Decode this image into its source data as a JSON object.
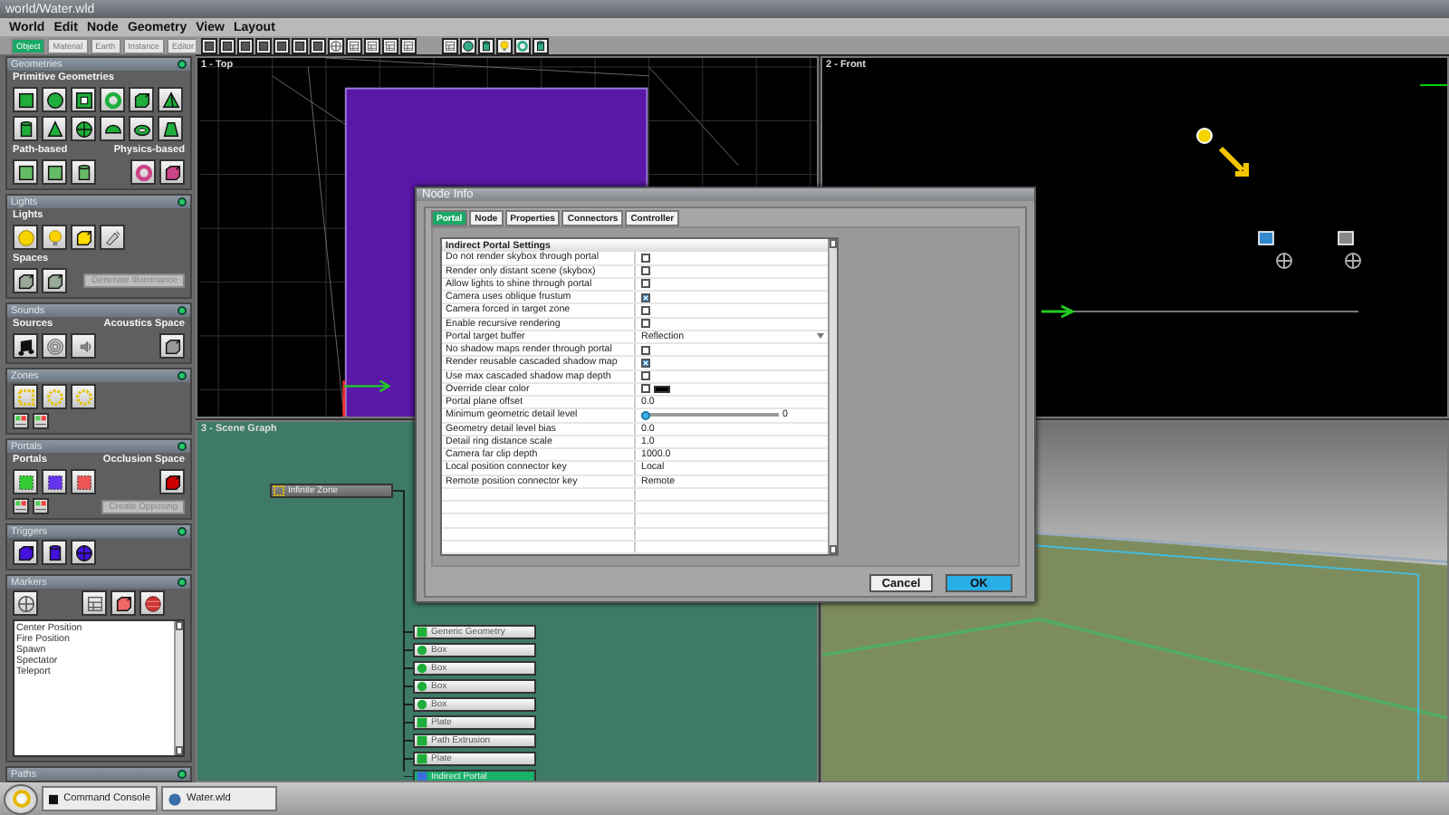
{
  "window": {
    "title": "world/Water.wld"
  },
  "menu": [
    "World",
    "Edit",
    "Node",
    "Geometry",
    "View",
    "Layout"
  ],
  "mode_tabs": [
    {
      "label": "Object",
      "selected": true
    },
    {
      "label": "Material",
      "selected": false
    },
    {
      "label": "Earth",
      "selected": false
    },
    {
      "label": "Instance",
      "selected": false
    },
    {
      "label": "Editor",
      "selected": false
    }
  ],
  "sidebar": {
    "geometries": {
      "title": "Geometries",
      "primitive_label": "Primitive Geometries",
      "path_label": "Path-based",
      "physics_label": "Physics-based"
    },
    "lights": {
      "title": "Lights",
      "lights_label": "Lights",
      "spaces_label": "Spaces",
      "button": {
        "label": "Generate Illuminance",
        "disabled": true
      }
    },
    "sounds": {
      "title": "Sounds",
      "sources_label": "Sources",
      "acoustics_label": "Acoustics Space"
    },
    "zones": {
      "title": "Zones"
    },
    "portals": {
      "title": "Portals",
      "portals_label": "Portals",
      "occlusion_label": "Occlusion Space",
      "button": {
        "label": "Create Opposing",
        "disabled": true
      }
    },
    "triggers": {
      "title": "Triggers"
    },
    "markers": {
      "title": "Markers",
      "list": [
        "Center Position",
        "Fire Position",
        "Spawn",
        "Spectator",
        "Teleport"
      ]
    },
    "paths": {
      "title": "Paths"
    }
  },
  "top_view": {
    "label": "1 - Top"
  },
  "front_view": {
    "label": "2 - Front"
  },
  "scene_graph": {
    "label": "3 - Scene Graph",
    "root": "Infinite Zone",
    "nodes": [
      {
        "label": "Generic Geometry",
        "kind": "plate",
        "selected": false
      },
      {
        "label": "Box",
        "kind": "box",
        "selected": false
      },
      {
        "label": "Box",
        "kind": "box",
        "selected": false
      },
      {
        "label": "Box",
        "kind": "box",
        "selected": false
      },
      {
        "label": "Box",
        "kind": "box",
        "selected": false
      },
      {
        "label": "Plate",
        "kind": "plate",
        "selected": false
      },
      {
        "label": "Path Extrusion",
        "kind": "path",
        "selected": false
      },
      {
        "label": "Plate",
        "kind": "plate",
        "selected": false
      },
      {
        "label": "Indirect Portal",
        "kind": "portal",
        "selected": true
      }
    ]
  },
  "dialog": {
    "title": "Node Info",
    "tabs": [
      {
        "label": "Portal",
        "selected": true
      },
      {
        "label": "Node",
        "selected": false
      },
      {
        "label": "Properties",
        "selected": false
      },
      {
        "label": "Connectors",
        "selected": false
      },
      {
        "label": "Controller",
        "selected": false
      }
    ],
    "section": "Indirect Portal Settings",
    "rows": [
      {
        "label": "Do not render skybox through portal",
        "kind": "check",
        "checked": false
      },
      {
        "label": "Render only distant scene (skybox)",
        "kind": "check",
        "checked": false
      },
      {
        "label": "Allow lights to shine through portal",
        "kind": "check",
        "checked": false
      },
      {
        "label": "Camera uses oblique frustum",
        "kind": "check",
        "checked": true
      },
      {
        "label": "Camera forced in target zone",
        "kind": "check",
        "checked": false
      },
      {
        "label": "Enable recursive rendering",
        "kind": "check",
        "checked": false
      },
      {
        "label": "Portal target buffer",
        "kind": "dropdown",
        "value": "Reflection"
      },
      {
        "label": "No shadow maps render through portal",
        "kind": "check",
        "checked": false
      },
      {
        "label": "Render reusable cascaded shadow map",
        "kind": "check",
        "checked": true
      },
      {
        "label": "Use max cascaded shadow map depth",
        "kind": "check",
        "checked": false
      },
      {
        "label": "Override clear color",
        "kind": "color",
        "checked": false,
        "color": "#000000"
      },
      {
        "label": "Portal plane offset",
        "kind": "text",
        "value": "0.0"
      },
      {
        "label": "Minimum geometric detail level",
        "kind": "slider",
        "level": 0,
        "reading": "0"
      },
      {
        "label": "Geometry detail level bias",
        "kind": "text",
        "value": "0.0"
      },
      {
        "label": "Detail ring distance scale",
        "kind": "text",
        "value": "1.0"
      },
      {
        "label": "Camera far clip depth",
        "kind": "text",
        "value": "1000.0"
      },
      {
        "label": "Local position connector key",
        "kind": "text",
        "value": "Local"
      },
      {
        "label": "Remote position connector key",
        "kind": "text",
        "value": "Remote"
      }
    ],
    "buttons": [
      {
        "label": "Cancel",
        "kind": "cancel"
      },
      {
        "label": "OK",
        "kind": "default"
      }
    ]
  },
  "taskbar": {
    "items": [
      "Command Console",
      "Water.wld"
    ]
  }
}
